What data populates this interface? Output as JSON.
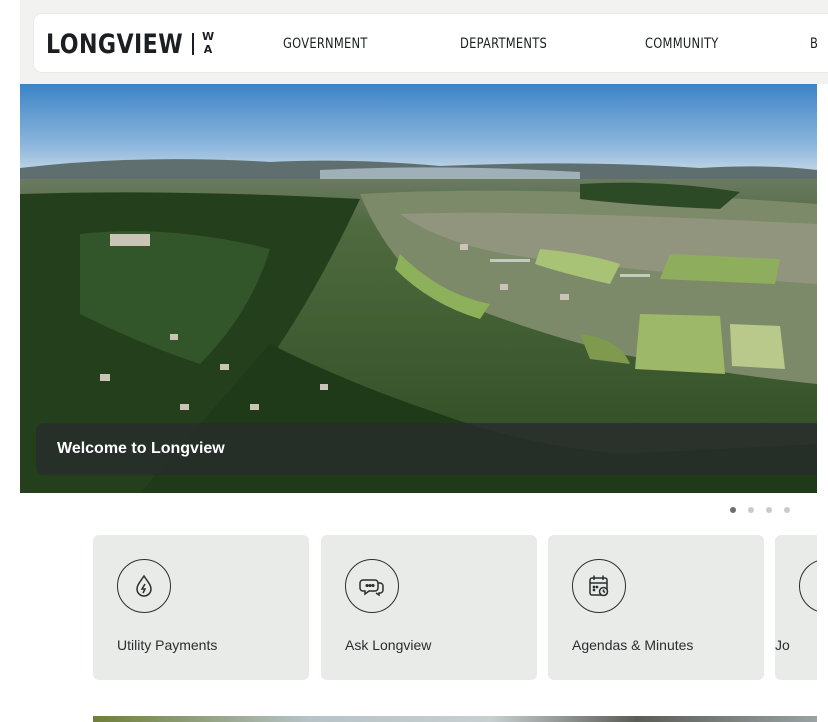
{
  "header": {
    "logo_text": "LONGVIEW",
    "logo_state_top": "W",
    "logo_state_bottom": "A",
    "nav": [
      "GOVERNMENT",
      "DEPARTMENTS",
      "COMMUNITY",
      "B"
    ]
  },
  "hero": {
    "caption": "Welcome to Longview",
    "slide_count": 4,
    "active_slide": 1
  },
  "cards": [
    {
      "label": "Utility Payments",
      "icon": "water-drop-bolt-icon"
    },
    {
      "label": "Ask Longview",
      "icon": "chat-bubbles-icon"
    },
    {
      "label": "Agendas & Minutes",
      "icon": "calendar-clock-icon"
    },
    {
      "label": "Jo",
      "icon": "circle-icon"
    }
  ],
  "colors": {
    "card_bg": "#e9ebe8",
    "caption_bg": "#282c2c",
    "text_dark": "#1c1f22"
  }
}
